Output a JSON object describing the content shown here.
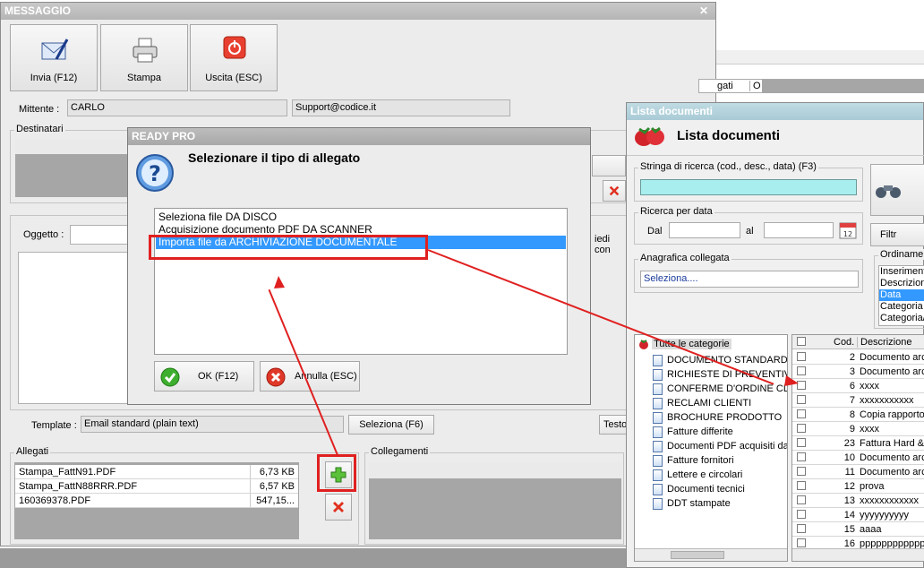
{
  "messaggio": {
    "title": "MESSAGGIO",
    "close": "✕",
    "invia": "Invia (F12)",
    "stampa": "Stampa",
    "uscita": "Uscita (ESC)",
    "mittente_label": "Mittente :",
    "mittente": "CARLO",
    "email": "Support@codice.it",
    "destinatari": "Destinatari",
    "oggetto_label": "Oggetto :",
    "template_label": "Template :",
    "template": "Email standard (plain text)",
    "seleziona": "Seleziona (F6)",
    "testo": "Testo",
    "allegati": "Allegati",
    "collegamenti": "Collegamenti",
    "piedi": "iedi con",
    "back_hdr1": "gati",
    "back_hdr2": "O",
    "files": [
      {
        "name": "Stampa_FattN91.PDF",
        "size": "6,73 KB"
      },
      {
        "name": "Stampa_FattN88RRR.PDF",
        "size": "6,57 KB"
      },
      {
        "name": "160369378.PDF",
        "size": "547,15..."
      }
    ]
  },
  "ready": {
    "title": "READY PRO",
    "question": "Selezionare il tipo di allegato",
    "options": [
      "Seleziona file DA DISCO",
      "Acquisizione documento PDF DA SCANNER",
      "Importa file da ARCHIVIAZIONE DOCUMENTALE"
    ],
    "ok": "OK (F12)",
    "annulla": "Annulla (ESC)"
  },
  "lista": {
    "title": "Lista documenti",
    "header": "Lista documenti",
    "search_label": "Stringa di ricerca (cod., desc., data) (F3)",
    "search_value": "",
    "data_label": "Ricerca per data",
    "dal": "Dal",
    "al": "al",
    "anagrafica_label": "Anagrafica collegata",
    "anagrafica_value": "Seleziona....",
    "filtra": "Filtr",
    "ordinamento": "Ordinamen",
    "sort_options": [
      "Inseriment",
      "Descrizione",
      "Data",
      "Categoria",
      "Categoria/"
    ],
    "tree_root": "Tutte le categorie",
    "categories": [
      "DOCUMENTO STANDARD",
      "RICHIESTE DI PREVENTIVO",
      "CONFERME D'ORDINE CLIEN",
      "RECLAMI CLIENTI",
      "BROCHURE PRODOTTO",
      "Fatture differite",
      "Documenti PDF acquisiti da",
      "Fatture fornitori",
      "Lettere e circolari",
      "Documenti tecnici",
      "DDT stampate"
    ],
    "col_cod": "Cod.",
    "col_desc": "Descrizione",
    "rows": [
      {
        "cod": "2",
        "desc": "Documento arc"
      },
      {
        "cod": "3",
        "desc": "Documento arc"
      },
      {
        "cod": "6",
        "desc": "xxxx"
      },
      {
        "cod": "7",
        "desc": "xxxxxxxxxxx"
      },
      {
        "cod": "8",
        "desc": "Copia rapporto"
      },
      {
        "cod": "9",
        "desc": "xxxx"
      },
      {
        "cod": "23",
        "desc": "Fattura Hard &"
      },
      {
        "cod": "10",
        "desc": "Documento arc"
      },
      {
        "cod": "11",
        "desc": "Documento arc"
      },
      {
        "cod": "12",
        "desc": "prova"
      },
      {
        "cod": "13",
        "desc": "xxxxxxxxxxxx"
      },
      {
        "cod": "14",
        "desc": "yyyyyyyyyy"
      },
      {
        "cod": "15",
        "desc": "aaaa"
      },
      {
        "cod": "16",
        "desc": "pppppppppppp"
      }
    ]
  },
  "colors": {
    "highlight": "#3399ff",
    "red": "#e02020",
    "search_bg": "#a8eeee",
    "teal_title": "#bcd8e0"
  }
}
